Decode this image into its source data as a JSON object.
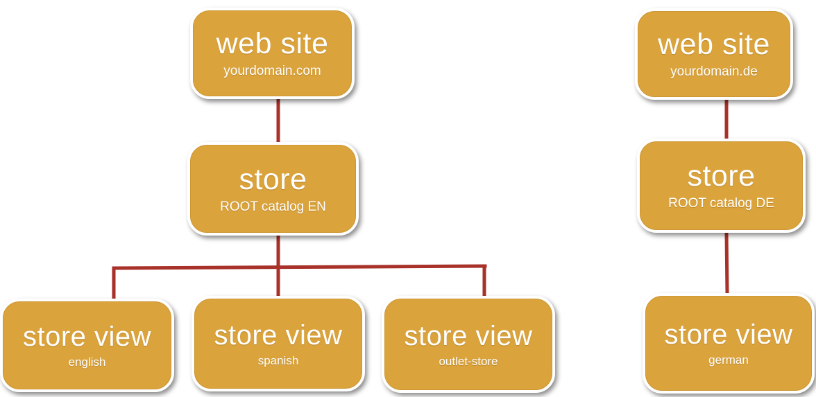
{
  "colors": {
    "node_fill": "#dba33c",
    "node_border": "#ffffff",
    "connector": "#a8322a",
    "text": "#ffffff",
    "background": "#ffffff"
  },
  "trees": [
    {
      "website": {
        "title": "web site",
        "subtitle": "yourdomain.com"
      },
      "store": {
        "title": "store",
        "subtitle": "ROOT catalog EN"
      },
      "store_views": [
        {
          "title": "store view",
          "subtitle": "english"
        },
        {
          "title": "store view",
          "subtitle": "spanish"
        },
        {
          "title": "store view",
          "subtitle": "outlet-store"
        }
      ]
    },
    {
      "website": {
        "title": "web site",
        "subtitle": "yourdomain.de"
      },
      "store": {
        "title": "store",
        "subtitle": "ROOT catalog DE"
      },
      "store_views": [
        {
          "title": "store view",
          "subtitle": "german"
        }
      ]
    }
  ]
}
